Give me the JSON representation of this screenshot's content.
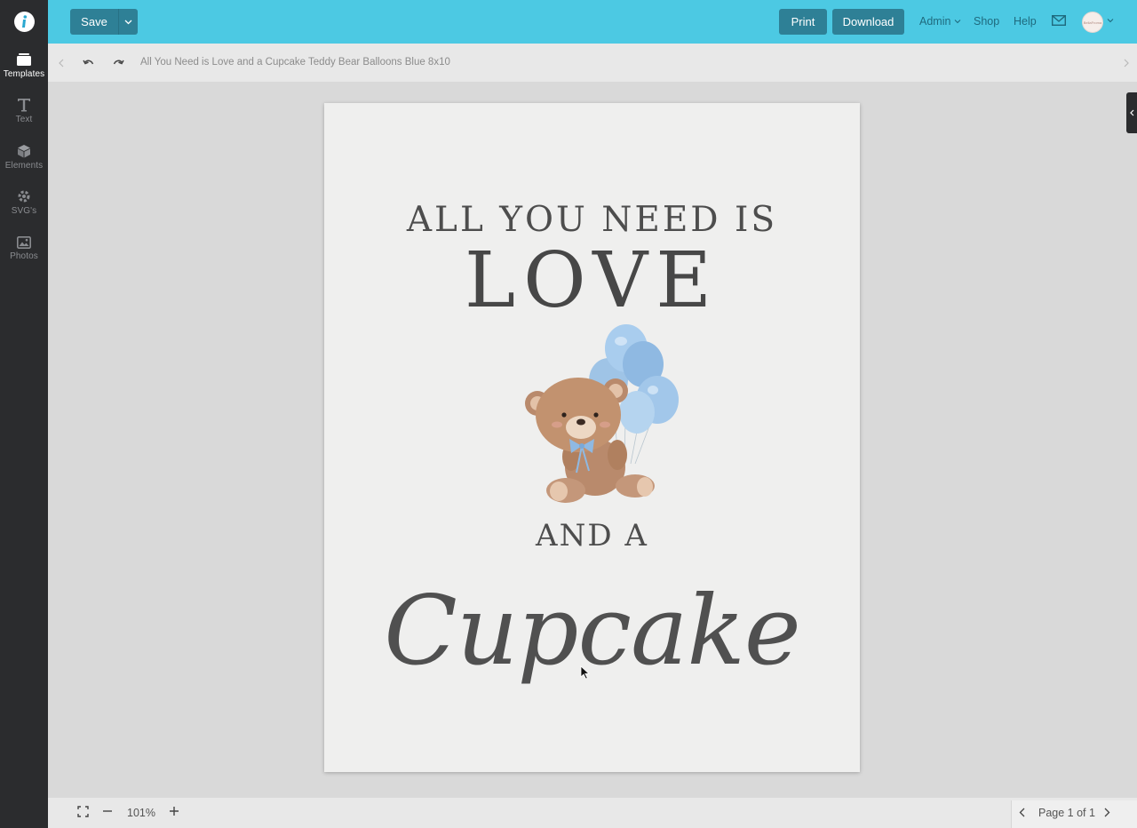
{
  "sidebar": {
    "items": [
      {
        "label": "Templates",
        "icon": "templates-icon"
      },
      {
        "label": "Text",
        "icon": "text-icon"
      },
      {
        "label": "Elements",
        "icon": "elements-icon"
      },
      {
        "label": "SVG's",
        "icon": "svgs-icon"
      },
      {
        "label": "Photos",
        "icon": "photos-icon"
      }
    ]
  },
  "topbar": {
    "save_label": "Save",
    "print_label": "Print",
    "download_label": "Download",
    "admin_label": "Admin",
    "shop_label": "Shop",
    "help_label": "Help",
    "avatar_text": "BellaFroma"
  },
  "subbar": {
    "doc_title": "All You Need is Love and a Cupcake Teddy Bear Balloons Blue 8x10"
  },
  "design": {
    "line1": "ALL YOU NEED IS",
    "line2": "LOVE",
    "line3": "AND A",
    "line4": "Cupcake"
  },
  "bottombar": {
    "zoom": "101%",
    "page_indicator": "Page 1 of 1"
  },
  "colors": {
    "topbar": "#4cc9e3",
    "button": "#2e8096",
    "rail": "#2b2c2e"
  }
}
